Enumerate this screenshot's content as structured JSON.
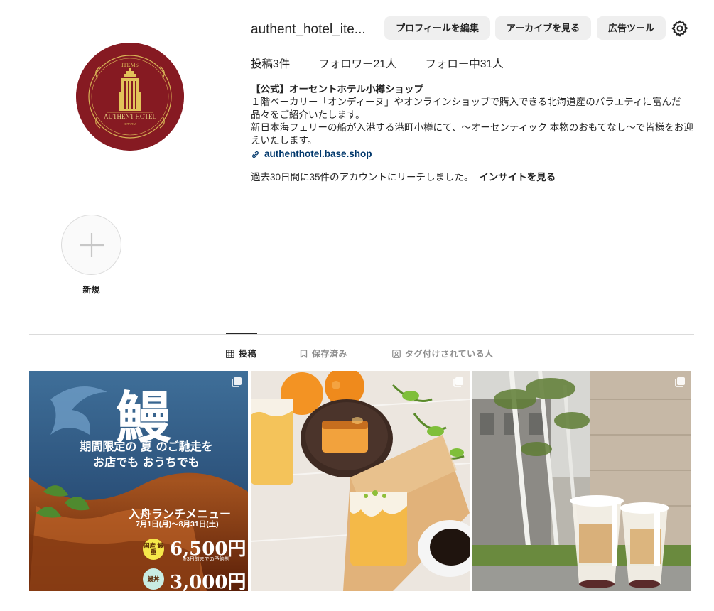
{
  "profile": {
    "username": "authent_hotel_ite...",
    "avatar_texts": {
      "top": "ITEMS",
      "main": "AUTHENT HOTEL",
      "city": "OTARU"
    },
    "buttons": {
      "edit": "プロフィールを編集",
      "archive": "アーカイブを見る",
      "ads": "広告ツール"
    },
    "settings_icon": "gear-icon"
  },
  "stats": {
    "posts": "投稿3件",
    "followers": "フォロワー21人",
    "following": "フォロー中31人"
  },
  "bio": {
    "name": "【公式】オーセントホテル小樽ショップ",
    "lines": [
      "１階ベーカリー「オンディーヌ」やオンラインショップで購入できる北海道産のバラエティに富んだ品々をご紹介いたします。",
      "新日本海フェリーの船が入港する港町小樽にて、～オーセンティック 本物のおもてなし～で皆様をお迎えいたします。"
    ],
    "link": "authenthotel.base.shop"
  },
  "insights": {
    "text": "過去30日間に35件のアカウントにリーチしました。",
    "link": "インサイトを見る"
  },
  "highlights": [
    {
      "label": "新規"
    }
  ],
  "tabs": [
    {
      "label": "投稿",
      "icon": "grid-icon",
      "active": true
    },
    {
      "label": "保存済み",
      "icon": "bookmark-icon",
      "active": false
    },
    {
      "label": "タグ付けされている人",
      "icon": "tagged-icon",
      "active": false
    }
  ],
  "posts": [
    {
      "kind": "promo",
      "texts": {
        "kanji": "鰻",
        "sub_line1": "期間限定の 夏 のご馳走を",
        "sub_line2": "お店でも おうちでも",
        "lunch": "入舟ランチメニュー",
        "dates": "7月1日(月)～8月31日(土)",
        "badge1": "国産 鰻重",
        "price1": "6,500円",
        "note": "※3日前までの予約制",
        "badge2": "鰻丼",
        "price2": "3,000円"
      }
    },
    {
      "kind": "photo-cake"
    },
    {
      "kind": "photo-street"
    }
  ],
  "colors": {
    "avatar_bg": "#861a22",
    "gold": "#d8b456",
    "link": "#00376b",
    "button_bg": "#efefef"
  }
}
